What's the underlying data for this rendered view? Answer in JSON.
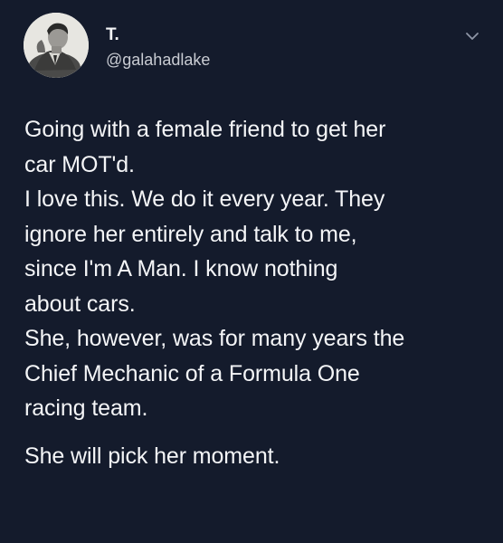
{
  "user": {
    "display_name": "T.",
    "handle": "@galahadlake",
    "avatar_icon": "profile-photo-avatar"
  },
  "menu": {
    "icon": "chevron-down-icon"
  },
  "tweet": {
    "line_1": "Going with a female friend to get her",
    "line_2": "car MOT'd.",
    "line_3": "I love this. We do it every year. They",
    "line_4": "ignore her entirely and talk to me,",
    "line_5": "since I'm A Man. I know nothing",
    "line_6": "about cars.",
    "line_7": "She, however, was for many years the",
    "line_8": "Chief Mechanic of a Formula One",
    "line_9": "racing team.",
    "line_10": "She will pick her moment."
  },
  "colors": {
    "background": "#141b2c",
    "text": "#f4f5f7",
    "secondary_text": "#c9ccd3",
    "chevron": "#8e96a6"
  }
}
